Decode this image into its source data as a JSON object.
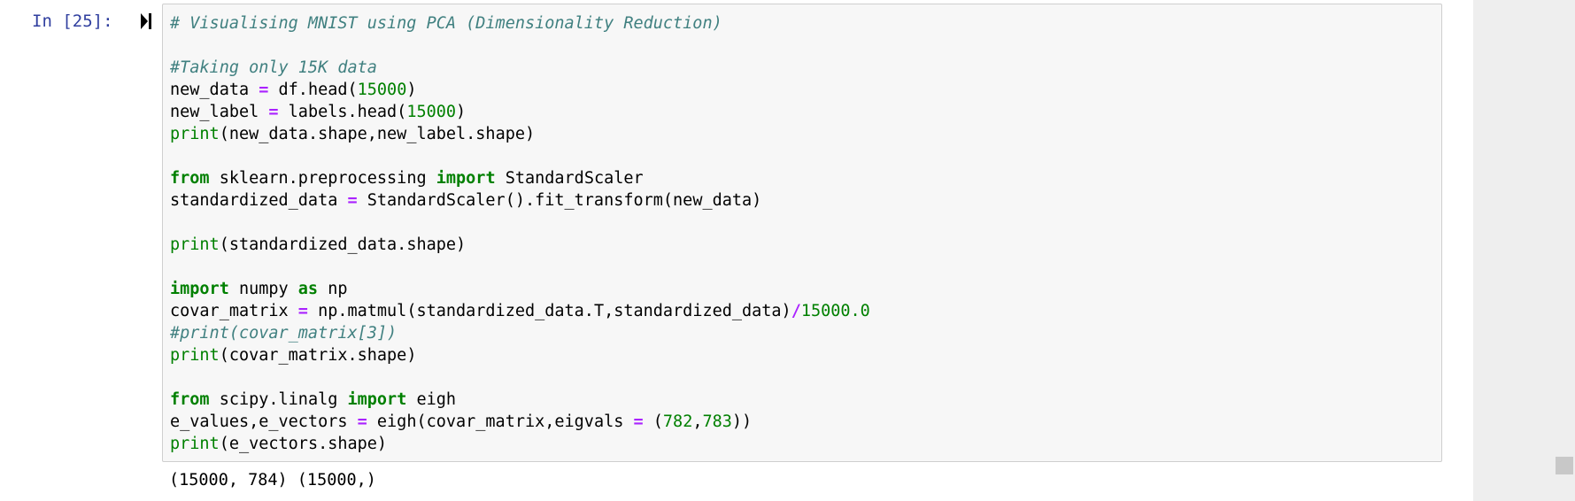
{
  "cell": {
    "prompt": "In [25]:",
    "code_lines": [
      [
        {
          "t": "# Visualising MNIST using PCA (Dimensionality Reduction)",
          "c": "cm-comment"
        }
      ],
      [],
      [
        {
          "t": "#Taking only 15K data",
          "c": "cm-comment"
        }
      ],
      [
        {
          "t": "new_data "
        },
        {
          "t": "=",
          "c": "cm-operator"
        },
        {
          "t": " df.head("
        },
        {
          "t": "15000",
          "c": "cm-number"
        },
        {
          "t": ")"
        }
      ],
      [
        {
          "t": "new_label "
        },
        {
          "t": "=",
          "c": "cm-operator"
        },
        {
          "t": " labels.head("
        },
        {
          "t": "15000",
          "c": "cm-number"
        },
        {
          "t": ")"
        }
      ],
      [
        {
          "t": "print",
          "c": "cm-builtin"
        },
        {
          "t": "(new_data.shape,new_label.shape)"
        }
      ],
      [],
      [
        {
          "t": "from",
          "c": "cm-keyword"
        },
        {
          "t": " sklearn.preprocessing "
        },
        {
          "t": "import",
          "c": "cm-keyword"
        },
        {
          "t": " StandardScaler"
        }
      ],
      [
        {
          "t": "standardized_data "
        },
        {
          "t": "=",
          "c": "cm-operator"
        },
        {
          "t": " StandardScaler().fit_transform(new_data)"
        }
      ],
      [],
      [
        {
          "t": "print",
          "c": "cm-builtin"
        },
        {
          "t": "(standardized_data.shape)"
        }
      ],
      [],
      [
        {
          "t": "import",
          "c": "cm-keyword"
        },
        {
          "t": " numpy "
        },
        {
          "t": "as",
          "c": "cm-keyword"
        },
        {
          "t": " np"
        }
      ],
      [
        {
          "t": "covar_matrix "
        },
        {
          "t": "=",
          "c": "cm-operator"
        },
        {
          "t": " np.matmul(standardized_data.T,standardized_data)"
        },
        {
          "t": "/",
          "c": "cm-operator"
        },
        {
          "t": "15000.0",
          "c": "cm-number"
        }
      ],
      [
        {
          "t": "#print(covar_matrix[3])",
          "c": "cm-comment"
        }
      ],
      [
        {
          "t": "print",
          "c": "cm-builtin"
        },
        {
          "t": "(covar_matrix.shape)"
        }
      ],
      [],
      [
        {
          "t": "from",
          "c": "cm-keyword"
        },
        {
          "t": " scipy.linalg "
        },
        {
          "t": "import",
          "c": "cm-keyword"
        },
        {
          "t": " eigh"
        }
      ],
      [
        {
          "t": "e_values,e_vectors "
        },
        {
          "t": "=",
          "c": "cm-operator"
        },
        {
          "t": " eigh(covar_matrix,eigvals "
        },
        {
          "t": "=",
          "c": "cm-operator"
        },
        {
          "t": " ("
        },
        {
          "t": "782",
          "c": "cm-number"
        },
        {
          "t": ","
        },
        {
          "t": "783",
          "c": "cm-number"
        },
        {
          "t": "))"
        }
      ],
      [
        {
          "t": "print",
          "c": "cm-builtin"
        },
        {
          "t": "(e_vectors.shape)"
        }
      ]
    ],
    "output_text": "(15000, 784) (15000,)"
  },
  "icons": {
    "run": "run-cell-icon"
  },
  "colors": {
    "prompt": "#303f9f",
    "comment": "#408080",
    "keyword": "#008000",
    "number": "#008000",
    "operator": "#aa22ff",
    "cell_background": "#f7f7f7",
    "cell_border": "#cfcfcf"
  }
}
